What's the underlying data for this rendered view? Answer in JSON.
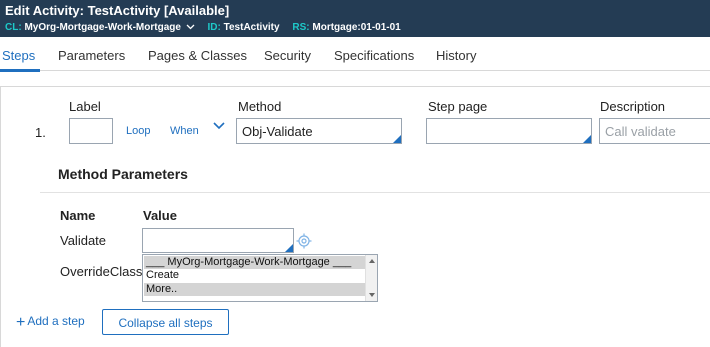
{
  "header": {
    "title_prefix": "Edit",
    "title": "Activity: TestActivity [Available]",
    "cl_key": "CL:",
    "cl_value": "MyOrg-Mortgage-Work-Mortgage",
    "id_key": "ID:",
    "id_value": "TestActivity",
    "rs_key": "RS:",
    "rs_value": "Mortgage:01-01-01"
  },
  "tabs": [
    {
      "label": "Steps",
      "active": true
    },
    {
      "label": "Parameters"
    },
    {
      "label": "Pages & Classes"
    },
    {
      "label": "Security"
    },
    {
      "label": "Specifications"
    },
    {
      "label": "History"
    }
  ],
  "step": {
    "number": "1.",
    "label_header": "Label",
    "method_header": "Method",
    "steppage_header": "Step page",
    "description_header": "Description",
    "label_value": "",
    "loop_link": "Loop",
    "when_link": "When",
    "method_value": "Obj-Validate",
    "steppage_value": "",
    "description_placeholder": "Call validate"
  },
  "method_params": {
    "title": "Method Parameters",
    "name_header": "Name",
    "value_header": "Value",
    "rows": [
      {
        "name": "Validate",
        "value": ""
      },
      {
        "name": "OverrideClass"
      }
    ],
    "override_options": [
      "___ MyOrg-Mortgage-Work-Mortgage ___",
      "Create",
      "More.."
    ]
  },
  "footer": {
    "add_step": "Add a step",
    "collapse_all": "Collapse all steps"
  },
  "colors": {
    "header_bg": "#243c54",
    "accent": "#1f6fbf",
    "header_key": "#1ec9c9"
  }
}
